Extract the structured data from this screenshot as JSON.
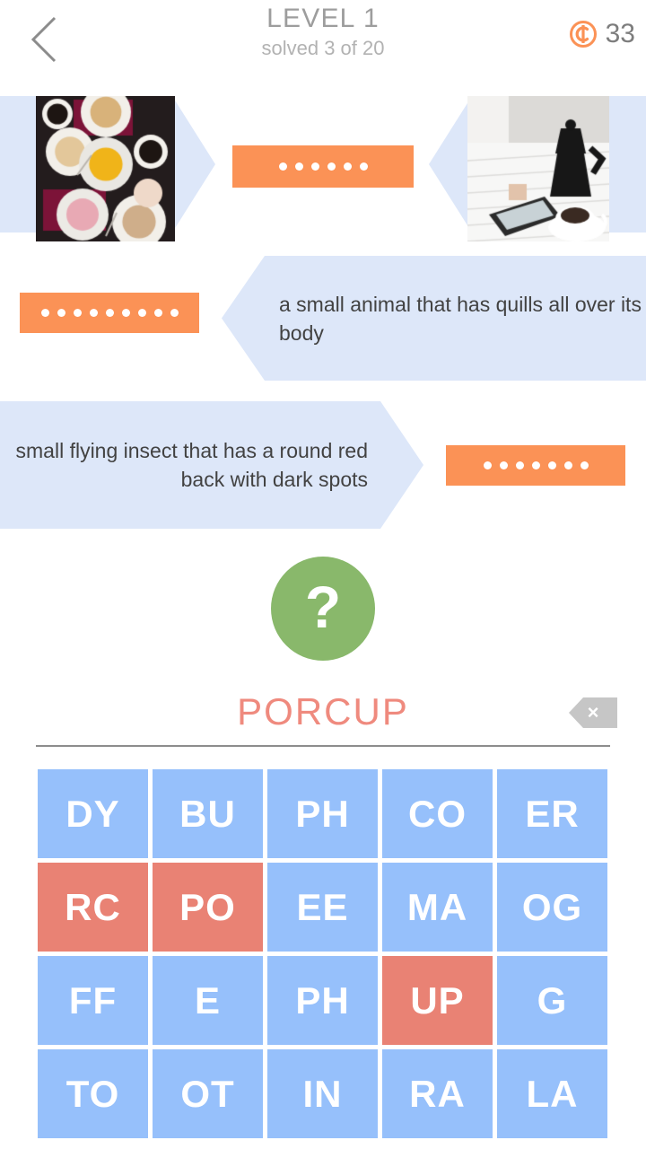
{
  "header": {
    "back_icon": "chevron-left-icon",
    "title": "LEVEL 1",
    "subtitle": "solved 3 of 20",
    "coin_icon": "coin-icon",
    "coin_count": "33",
    "title_color": "#9d9d9d",
    "coin_color": "#fb9256"
  },
  "puzzle_rows": [
    {
      "type": "image-image",
      "left_clue": {
        "kind": "image",
        "alt": "breakfast table with plates, pastries and cups of coffee"
      },
      "right_clue": {
        "kind": "image",
        "alt": "moka pot, tablet and cup of coffee on a white table"
      },
      "answer": {
        "length": 6,
        "solved": false
      }
    },
    {
      "type": "text-right",
      "clue_text": "a small animal that has quills all over its body",
      "answer": {
        "length": 9,
        "solved": false
      }
    },
    {
      "type": "text-left",
      "clue_text": "small flying insect that has a round red back with dark spots",
      "answer": {
        "length": 7,
        "solved": false
      }
    }
  ],
  "hint": {
    "icon": "question-mark-icon",
    "label": "?",
    "color": "#89b86b"
  },
  "input": {
    "typed_value": "PORCUP",
    "typed_color": "#ef8a7e",
    "backspace_icon": "backspace-delete-icon",
    "backspace_label": "×"
  },
  "grid": {
    "colors": {
      "available": "#96c0fb",
      "used": "#e98274",
      "text": "#ffffff"
    },
    "tiles": [
      {
        "label": "DY",
        "used": false
      },
      {
        "label": "BU",
        "used": false
      },
      {
        "label": "PH",
        "used": false
      },
      {
        "label": "CO",
        "used": false
      },
      {
        "label": "ER",
        "used": false
      },
      {
        "label": "RC",
        "used": true
      },
      {
        "label": "PO",
        "used": true
      },
      {
        "label": "EE",
        "used": false
      },
      {
        "label": "MA",
        "used": false
      },
      {
        "label": "OG",
        "used": false
      },
      {
        "label": "FF",
        "used": false
      },
      {
        "label": "E",
        "used": false
      },
      {
        "label": "PH",
        "used": false
      },
      {
        "label": "UP",
        "used": true
      },
      {
        "label": "G",
        "used": false
      },
      {
        "label": "TO",
        "used": false
      },
      {
        "label": "OT",
        "used": false
      },
      {
        "label": "IN",
        "used": false
      },
      {
        "label": "RA",
        "used": false
      },
      {
        "label": "LA",
        "used": false
      }
    ]
  },
  "theme": {
    "orange": "#fb9256",
    "clue_blue": "#dde7f9",
    "background": "#ffffff"
  }
}
